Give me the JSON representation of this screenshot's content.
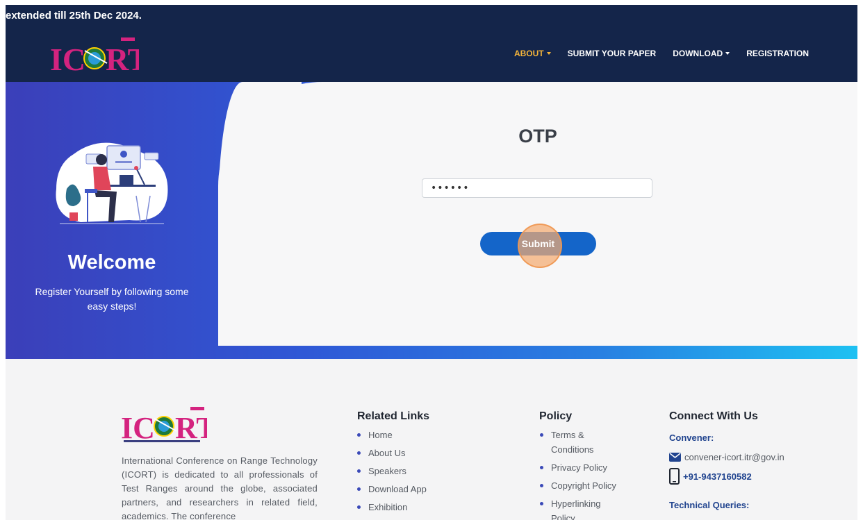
{
  "header": {
    "ticker": "extended till 25th Dec 2024.",
    "logo_text": "ICORT",
    "nav": [
      {
        "label": "ABOUT",
        "dropdown": true,
        "active": true
      },
      {
        "label": "SUBMIT YOUR PAPER",
        "dropdown": false,
        "active": false
      },
      {
        "label": "DOWNLOAD",
        "dropdown": true,
        "active": false
      },
      {
        "label": "REGISTRATION",
        "dropdown": false,
        "active": false
      }
    ]
  },
  "hero": {
    "welcome_title": "Welcome",
    "welcome_subtitle": "Register Yourself by following some easy steps!",
    "form_title": "OTP",
    "otp_value": "••••••",
    "submit_label": "Submit"
  },
  "footer": {
    "logo_text": "ICORT",
    "about_text": "International Conference on Range Technology (ICORT) is dedicated to all professionals of Test Ranges around the globe, associated partners, and researchers in related field, academics. The conference",
    "related_links": {
      "heading": "Related Links",
      "items": [
        "Home",
        "About Us",
        "Speakers",
        "Download App",
        "Exhibition"
      ]
    },
    "policy": {
      "heading": "Policy",
      "items": [
        "Terms & Conditions",
        "Privacy Policy",
        "Copyright Policy",
        "Hyperlinking Policy"
      ]
    },
    "connect": {
      "heading": "Connect With Us",
      "convener_label": "Convener:",
      "email": "convener-icort.itr@gov.in",
      "phone": "+91-9437160582",
      "technical_label": "Technical Queries:"
    }
  },
  "colors": {
    "header_bg": "#14254a",
    "nav_active": "#f4b43a",
    "button": "#1465c9",
    "accent_link": "#21448f"
  }
}
